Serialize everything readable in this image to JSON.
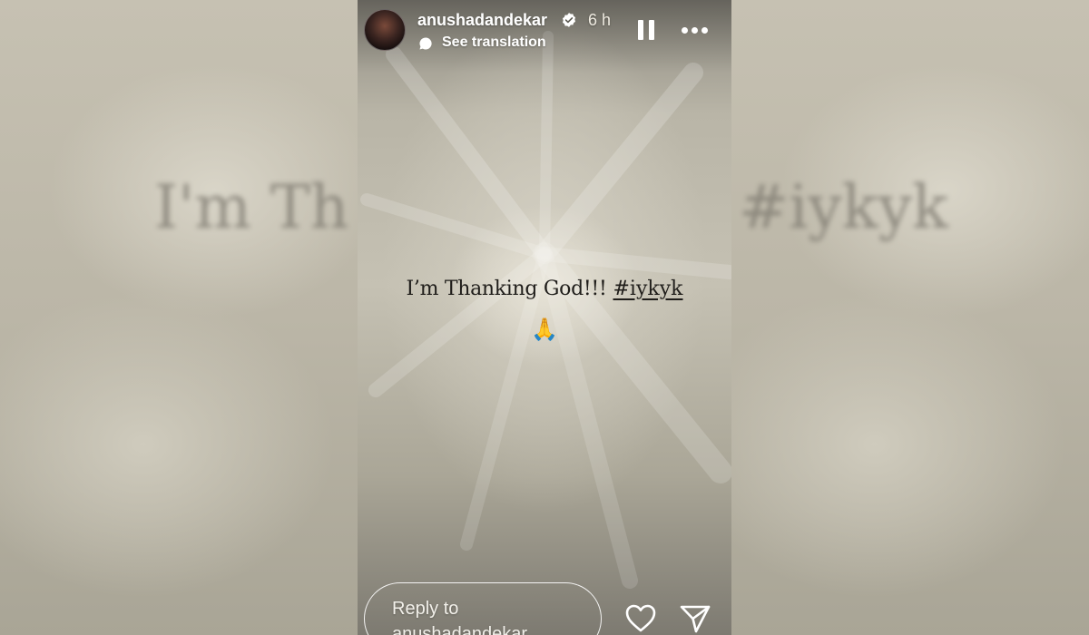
{
  "story": {
    "username": "anushadandekar",
    "time_ago": "6 h",
    "see_translation": "See translation",
    "caption_text": "I’m Thanking God!!!",
    "hashtag": "#iykyk",
    "emoji": "🙏",
    "reply_placeholder": "Reply to anushadandekar"
  },
  "backdrop": {
    "left_text": "I'm Th",
    "right_text": "#iykyk"
  },
  "icons": {
    "verified": "verified-badge-icon",
    "translate": "speech-bubble-icon",
    "pause": "pause-icon",
    "more": "more-horizontal-icon",
    "like": "heart-icon",
    "share": "paper-plane-icon"
  },
  "colors": {
    "text_on_media": "#ffffff",
    "caption": "#1f1d1a"
  }
}
